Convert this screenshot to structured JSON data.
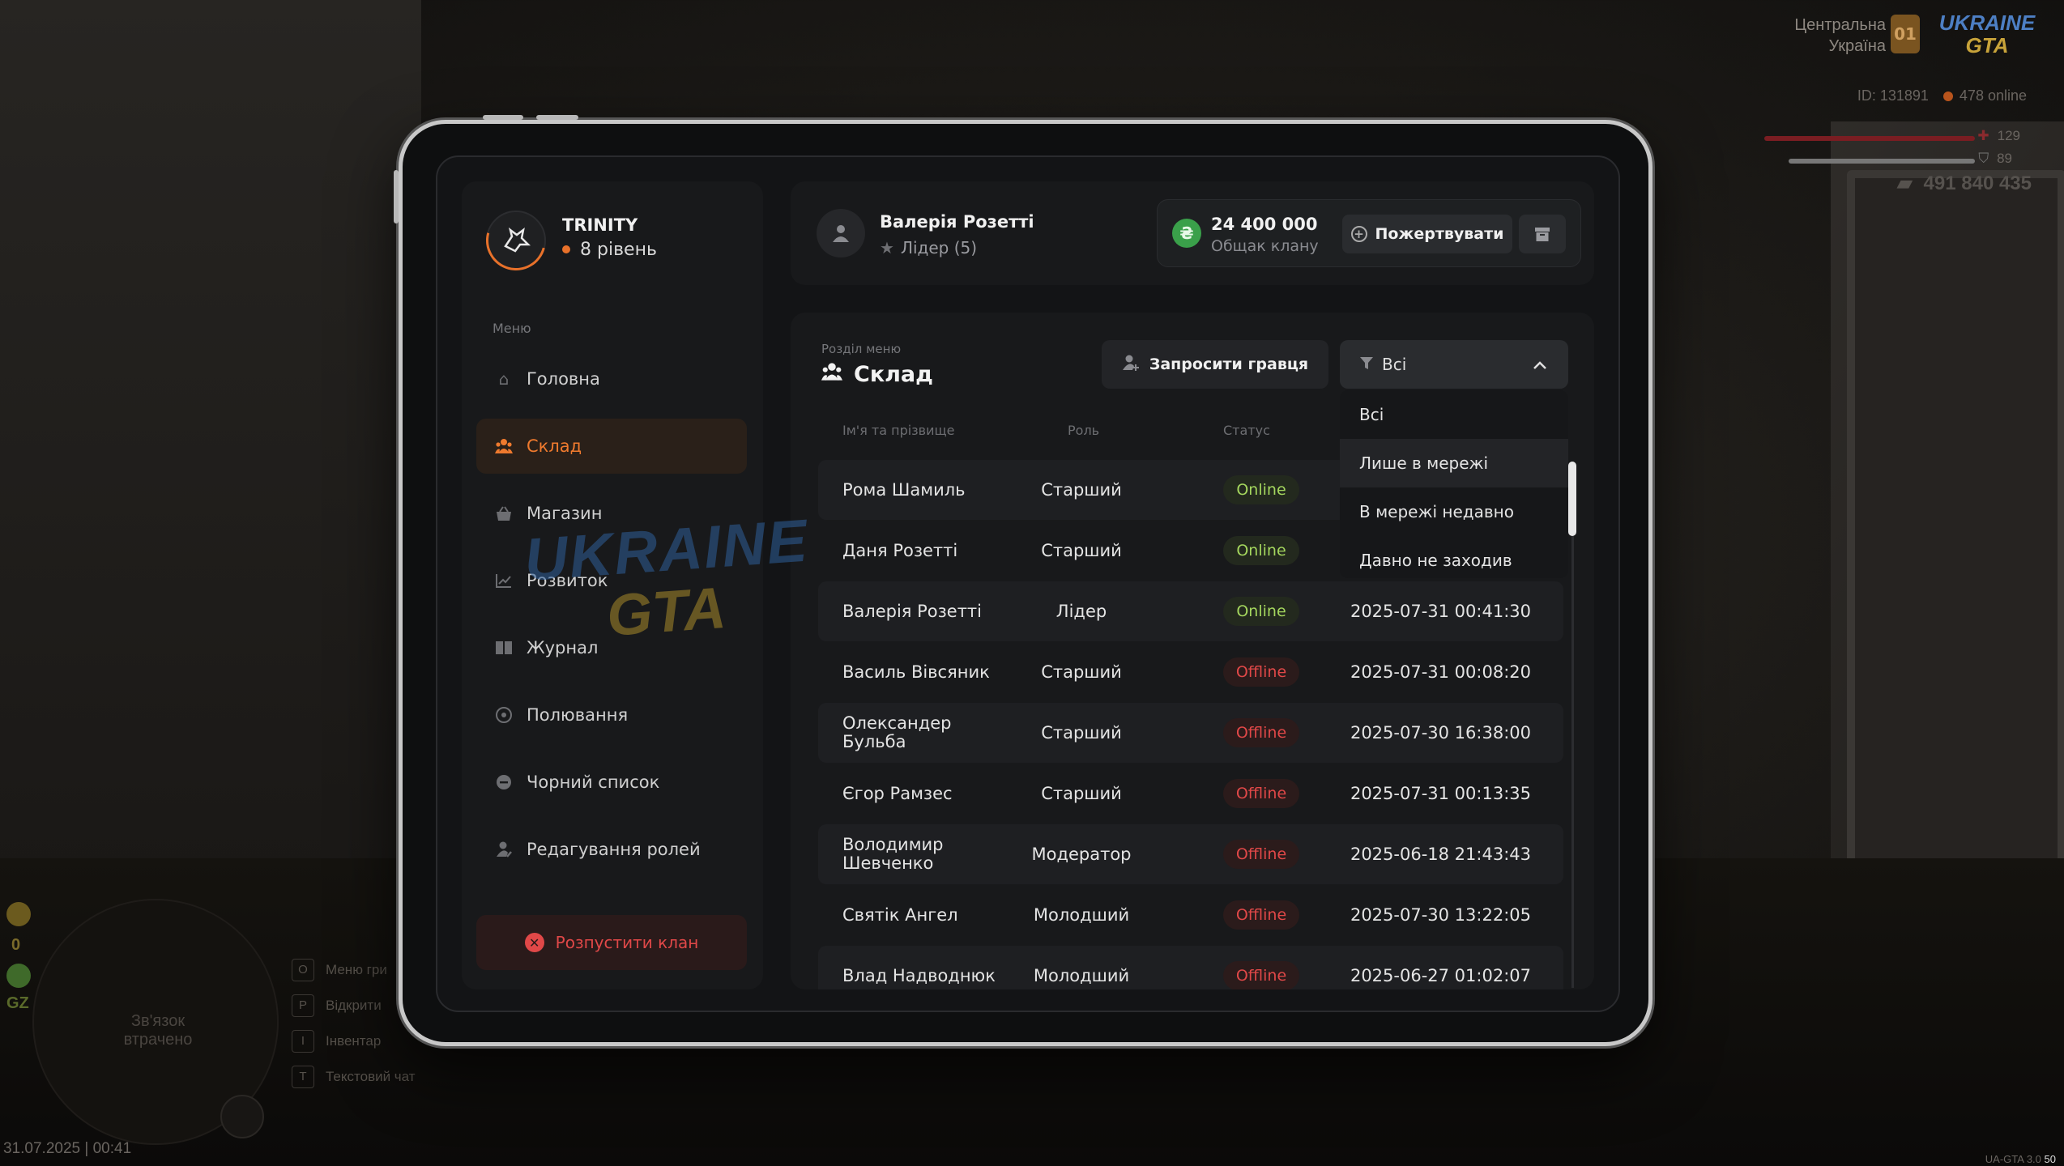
{
  "hud": {
    "region_line1": "Центральна",
    "region_line2": "Україна",
    "region_code": "01",
    "logo_top": "UKRAINE",
    "logo_bottom": "GTA",
    "player_id": "ID: 131891",
    "online": "478 online",
    "health": "129",
    "armor": "89",
    "money": "491 840 435",
    "minimap_status": "Зв'язок втрачено",
    "side_value_1": "0",
    "side_value_2": "GZ",
    "keys": [
      {
        "key": "O",
        "label": "Меню гри"
      },
      {
        "key": "P",
        "label": "Відкрити"
      },
      {
        "key": "I",
        "label": "Інвентар"
      },
      {
        "key": "T",
        "label": "Текстовий чат"
      }
    ],
    "datetime": "31.07.2025 | 00:41",
    "version": "UA-GTA 3.0",
    "version_suffix": "50"
  },
  "sidebar": {
    "clan_name": "TRINITY",
    "clan_level": "8 рівень",
    "menu_label": "Меню",
    "items": [
      {
        "label": "Головна",
        "icon": "home-icon"
      },
      {
        "label": "Склад",
        "icon": "people-icon"
      },
      {
        "label": "Магазин",
        "icon": "basket-icon"
      },
      {
        "label": "Розвиток",
        "icon": "chart-icon"
      },
      {
        "label": "Журнал",
        "icon": "book-icon"
      },
      {
        "label": "Полювання",
        "icon": "target-icon"
      },
      {
        "label": "Чорний список",
        "icon": "block-icon"
      },
      {
        "label": "Редагування ролей",
        "icon": "user-edit-icon"
      }
    ],
    "disband_label": "Розпустити клан"
  },
  "header": {
    "user_name": "Валерія Розетті",
    "user_role": "Лідер (5)",
    "bank_amount": "24 400 000",
    "bank_label": "Общак клану",
    "donate_label": "Пожертвувати"
  },
  "main": {
    "section_sub": "Розділ меню",
    "section_title": "Склад",
    "invite_label": "Запросити гравця",
    "filter_value": "Всі",
    "columns": {
      "name": "Ім'я та прізвище",
      "role": "Роль",
      "status": "Статус"
    },
    "filter_options": [
      "Всі",
      "Лише в мережі",
      "В мережі недавно",
      "Давно не заходив"
    ],
    "members": [
      {
        "name": "Рома Шамиль",
        "role": "Старший",
        "status": "Online",
        "seen": ""
      },
      {
        "name": "Даня Розетті",
        "role": "Старший",
        "status": "Online",
        "seen": ""
      },
      {
        "name": "Валерія Розетті",
        "role": "Лідер",
        "status": "Online",
        "seen": "2025-07-31 00:41:30"
      },
      {
        "name": "Василь Вівсяник",
        "role": "Старший",
        "status": "Offline",
        "seen": "2025-07-31 00:08:20"
      },
      {
        "name": "Олександер Бульба",
        "role": "Старший",
        "status": "Offline",
        "seen": "2025-07-30 16:38:00"
      },
      {
        "name": "Єгор Рамзес",
        "role": "Старший",
        "status": "Offline",
        "seen": "2025-07-31 00:13:35"
      },
      {
        "name": "Володимир Шевченко",
        "role": "Модератор",
        "status": "Offline",
        "seen": "2025-06-18 21:43:43"
      },
      {
        "name": "Святік Ангел",
        "role": "Молодший",
        "status": "Offline",
        "seen": "2025-07-30 13:22:05"
      },
      {
        "name": "Влад Надводнюк",
        "role": "Молодший",
        "status": "Offline",
        "seen": "2025-06-27 01:02:07"
      }
    ],
    "watermark_top": "UKRAINE",
    "watermark_bottom": "GTA"
  },
  "colors": {
    "accent": "#ef7a2e",
    "online": "#a4d65e",
    "offline": "#e04848",
    "bank": "#3aa04a"
  }
}
